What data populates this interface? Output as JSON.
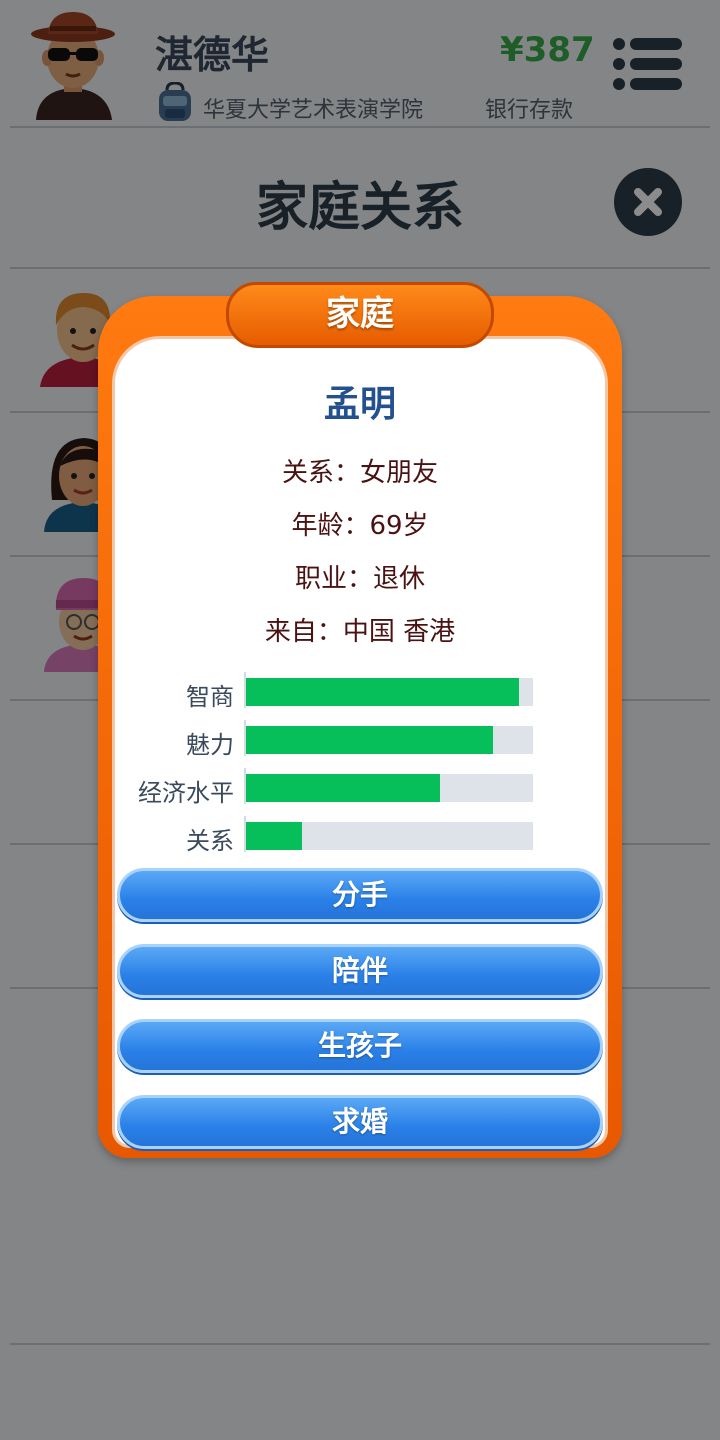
{
  "header": {
    "player_name": "湛德华",
    "school": "华夏大学艺术表演学院",
    "money": "¥387",
    "bank_label": "银行存款"
  },
  "page": {
    "title": "家庭关系"
  },
  "modal": {
    "tab_label": "家庭",
    "person_name": "孟明",
    "info": [
      "关系：女朋友",
      "年龄：69岁",
      "职业：退休",
      "来自：中国 香港"
    ],
    "stats": [
      {
        "label": "智商",
        "value": 0.95
      },
      {
        "label": "魅力",
        "value": 0.86
      },
      {
        "label": "经济水平",
        "value": 0.675
      },
      {
        "label": "关系",
        "value": 0.195
      }
    ],
    "actions": [
      "分手",
      "陪伴",
      "生孩子",
      "求婚"
    ]
  },
  "colors": {
    "money": "#38a84a",
    "modal_frame": "#ff6a00",
    "stat_fill": "#07bf5a",
    "button": "#2a80e8"
  }
}
